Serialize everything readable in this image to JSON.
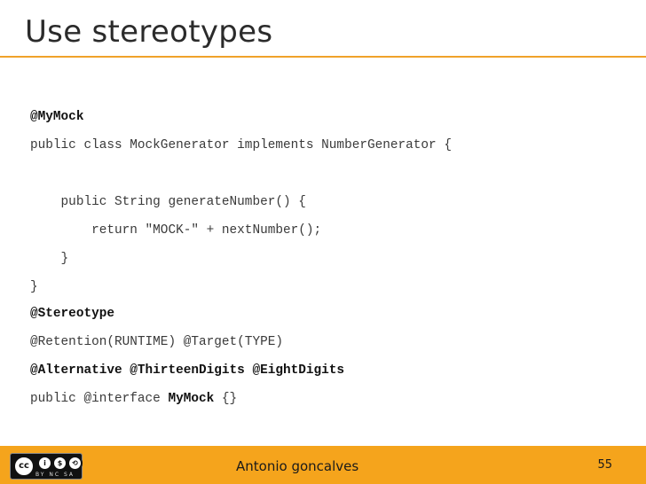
{
  "slide": {
    "title": "Use stereotypes"
  },
  "code": {
    "lines": [
      {
        "parts": [
          {
            "text": "@MyMock",
            "bold": true
          }
        ]
      },
      {
        "parts": [
          {
            "text": "public class MockGenerator implements NumberGenerator {",
            "bold": false
          }
        ]
      },
      {
        "parts": [
          {
            "text": "    public String generateNumber() {",
            "bold": false
          }
        ]
      },
      {
        "parts": [
          {
            "text": "        return \"MOCK-\" + nextNumber();",
            "bold": false
          }
        ]
      },
      {
        "parts": [
          {
            "text": "    }",
            "bold": false
          }
        ]
      },
      {
        "parts": [
          {
            "text": "}",
            "bold": false
          }
        ]
      },
      {
        "parts": [
          {
            "text": "@Stereotype",
            "bold": true
          }
        ]
      },
      {
        "parts": [
          {
            "text": "@Retention(RUNTIME) @Target(TYPE)",
            "bold": false
          }
        ]
      },
      {
        "parts": [
          {
            "text": "@Alternative @ThirteenDigits @EightDigits",
            "bold": true
          }
        ]
      },
      {
        "parts": [
          {
            "text": "public @interface ",
            "bold": false
          },
          {
            "text": "MyMock",
            "bold": true
          },
          {
            "text": " {}",
            "bold": false
          }
        ]
      }
    ]
  },
  "footer": {
    "author": "Antonio goncalves",
    "page_number": "55",
    "license_badge": {
      "icons": [
        "cc",
        "by",
        "nc",
        "sa"
      ],
      "strip_text": "BY  NC  SA"
    },
    "background_color": "#f5a41c"
  },
  "colors": {
    "accent": "#f0a22a"
  }
}
